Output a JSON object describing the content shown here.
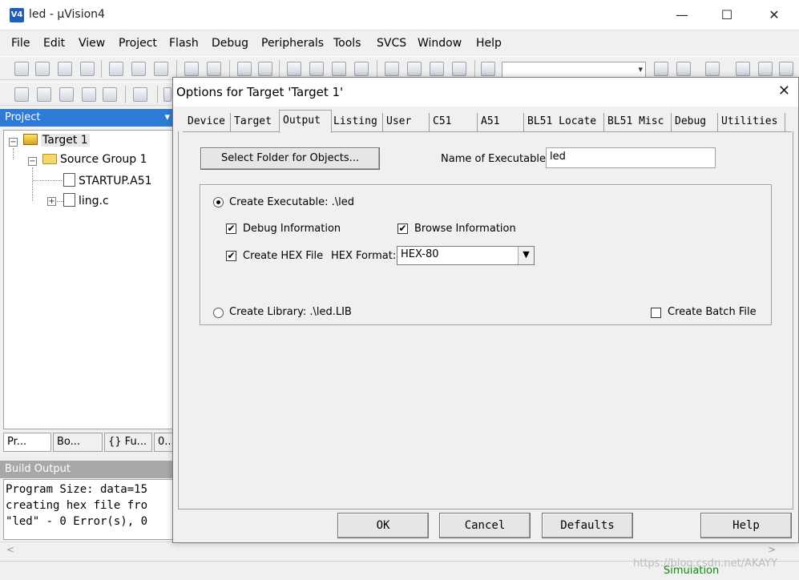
{
  "window": {
    "title": "led  - µVision4",
    "app_icon_label": "V4",
    "minimize": "—",
    "maximize": "☐",
    "close": "✕"
  },
  "menu": [
    "File",
    "Edit",
    "View",
    "Project",
    "Flash",
    "Debug",
    "Peripherals",
    "Tools",
    "SVCS",
    "Window",
    "Help"
  ],
  "project_panel": {
    "title": "Project",
    "dropdown": "▾",
    "tree": {
      "target": "Target 1",
      "group": "Source Group 1",
      "files": [
        "STARTUP.A51",
        "ling.c"
      ]
    },
    "tabs": [
      "Pr...",
      "Bo...",
      "{} Fu...",
      "0..."
    ]
  },
  "build_output": {
    "title": "Build Output",
    "lines": [
      "Program Size: data=15",
      "creating hex file fro",
      "\"led\" - 0 Error(s), 0"
    ]
  },
  "status": {
    "mode": "Simulation"
  },
  "watermark": "https://blog.csdn.net/AKAYY",
  "dialog": {
    "title": "Options for Target 'Target 1'",
    "close": "✕",
    "tabs": [
      "Device",
      "Target",
      "Output",
      "Listing",
      "User",
      "C51",
      "A51",
      "BL51 Locate",
      "BL51 Misc",
      "Debug",
      "Utilities"
    ],
    "active_tab": "Output",
    "output": {
      "select_folder_button": "Select Folder for Objects...",
      "name_label": "Name of Executable:",
      "name_value": "led",
      "create_executable_label": "Create Executable:  .\\led",
      "debug_info_label": "Debug Information",
      "browse_info_label": "Browse Information",
      "create_hex_label": "Create HEX File",
      "hex_format_label": "HEX Format:",
      "hex_format_value": "HEX-80",
      "create_library_label": "Create Library:  .\\led.LIB",
      "create_batch_label": "Create Batch File"
    },
    "buttons": {
      "ok": "OK",
      "cancel": "Cancel",
      "defaults": "Defaults",
      "help": "Help"
    }
  }
}
